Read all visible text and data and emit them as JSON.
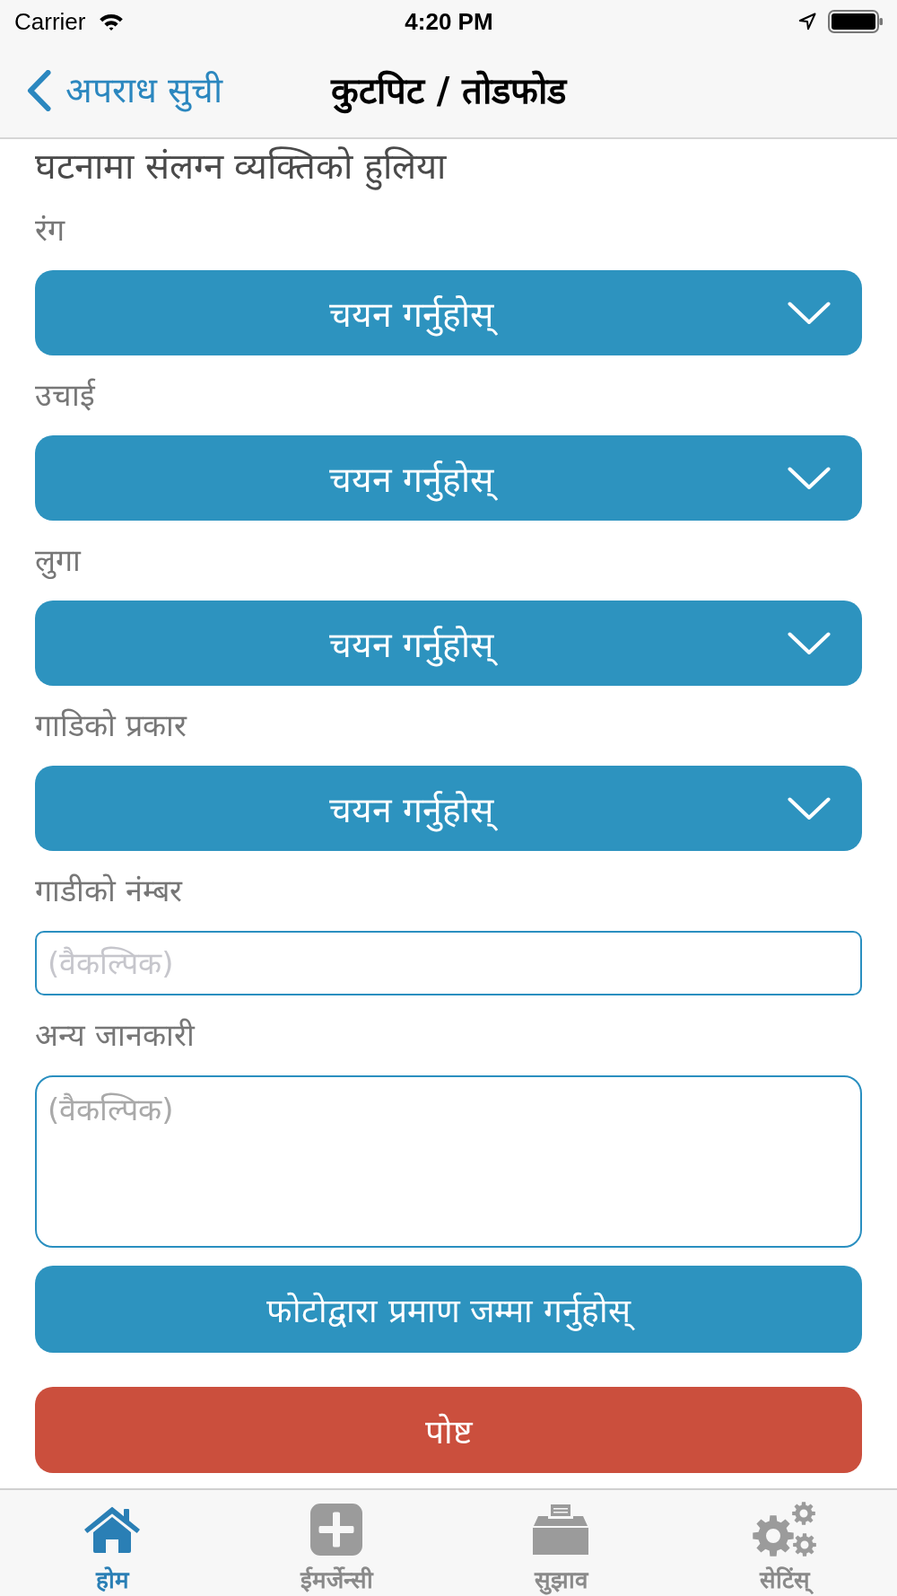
{
  "status_bar": {
    "carrier": "Carrier",
    "time": "4:20 PM"
  },
  "nav_bar": {
    "back": "अपराध सुची",
    "title": "कुटपिट / तोडफोड"
  },
  "form": {
    "heading": "घटनामा संलग्न व्यक्तिको हुलिया",
    "fields": [
      {
        "kind": "dropdown",
        "label": "रंग",
        "value": "चयन गर्नुहोस्"
      },
      {
        "kind": "dropdown",
        "label": "उचाई",
        "value": "चयन गर्नुहोस्"
      },
      {
        "kind": "dropdown",
        "label": "लुगा",
        "value": "चयन गर्नुहोस्"
      },
      {
        "kind": "dropdown",
        "label": "गाडिको प्रकार",
        "value": "चयन गर्नुहोस्"
      },
      {
        "kind": "text",
        "label": "गाडीको नंम्बर",
        "placeholder": "(वैकल्पिक)"
      },
      {
        "kind": "textarea",
        "label": "अन्य जानकारी",
        "placeholder": "(वैकल्पिक)"
      }
    ]
  },
  "buttons": [
    {
      "kind": "primary",
      "label": "फोटोद्वारा प्रमाण जम्मा गर्नुहोस्"
    },
    {
      "kind": "danger",
      "label": "पोष्ट"
    }
  ],
  "tab_bar": [
    {
      "label": "होम",
      "selected": true
    },
    {
      "label": "ईमर्जेन्सी",
      "selected": false
    },
    {
      "label": "सुझाव",
      "selected": false
    },
    {
      "label": "सेटिंस्",
      "selected": false
    }
  ]
}
